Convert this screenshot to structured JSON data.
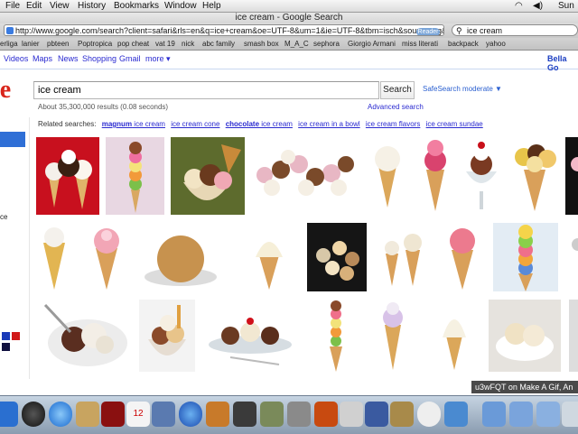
{
  "menubar": {
    "items": [
      "File",
      "Edit",
      "View",
      "History",
      "Bookmarks",
      "Window",
      "Help"
    ],
    "clock": "Sun"
  },
  "window": {
    "title": "ice cream - Google Search"
  },
  "toolbar": {
    "url": "http://www.google.com/search?client=safari&rls=en&q=ice+cream&oe=UTF-8&um=1&ie=UTF-8&tbm=isch&source=og&sa=",
    "reader_label": "Reader",
    "search_value": "ice cream"
  },
  "bookmarks": [
    "erliga",
    "lanier",
    "pbteen",
    "Poptropica",
    "pop cheat",
    "vat 19",
    "nick",
    "abc family",
    "smash box",
    "M_A_C",
    "sephora",
    "Giorgio Armani",
    "miss literati",
    "backpack",
    "yahoo"
  ],
  "gbar": {
    "links": [
      "Videos",
      "Maps",
      "News",
      "Shopping",
      "Gmail",
      "more ▾"
    ],
    "user": "Bella Go"
  },
  "logo": {
    "text": "gle"
  },
  "search": {
    "query": "ice cream",
    "button_label": "Search",
    "safesearch": "SafeSearch moderate ▼",
    "stats": "About 35,300,000 results (0.08 seconds)",
    "advanced": "Advanced search"
  },
  "related": {
    "label": "Related searches:",
    "items": [
      {
        "bold": "magnum",
        "rest": " ice cream"
      },
      {
        "bold": "",
        "rest": "ice cream cone"
      },
      {
        "bold": "chocolate",
        "rest": " ice cream"
      },
      {
        "bold": "",
        "rest": "ice cream in a bowl"
      },
      {
        "bold": "",
        "rest": "ice cream flavors"
      },
      {
        "bold": "",
        "rest": "ice cream sundae"
      }
    ]
  },
  "leftnav": {
    "partial_label": "ce"
  },
  "watermark": "u3wFQT on Make A Gif, An",
  "colors": {
    "accent": "#2f6fd6",
    "link": "#2a2ad0"
  }
}
